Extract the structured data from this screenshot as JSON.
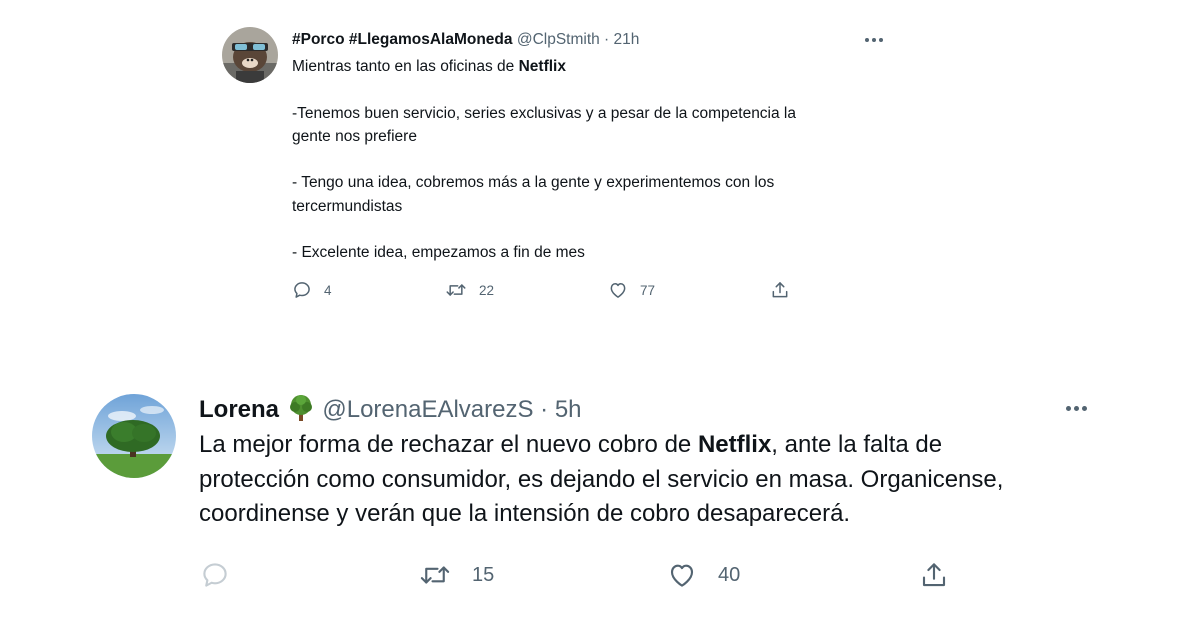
{
  "tweets": [
    {
      "display_name": "#Porco #LlegamosAlaMoneda",
      "handle": "@ClpStmith",
      "time": "21h",
      "text_intro": "Mientras tanto en las oficinas de ",
      "text_bold": "Netflix",
      "text_rest": "\n\n-Tenemos buen servicio, series exclusivas y a pesar de la competencia la\ngente nos prefiere\n\n- Tengo una idea, cobremos más a la gente y experimentemos con los\ntercermundistas\n\n- Excelente idea, empezamos a fin de mes",
      "replies": "4",
      "retweets": "22",
      "likes": "77",
      "avatar_icon": "cartoon-avatar"
    },
    {
      "display_name": "Lorena",
      "name_emoji": "tree-emoji",
      "handle": "@LorenaEAlvarezS",
      "time": "5h",
      "text_intro": "La mejor forma de rechazar el nuevo cobro de ",
      "text_bold": "Netflix",
      "text_rest": ", ante la falta de\nprotección como consumidor, es dejando el servicio en masa. Organicense,\ncoordinense y verán que la intensión de cobro desaparecerá.",
      "retweets": "15",
      "likes": "40",
      "avatar_icon": "tree-landscape-avatar"
    }
  ],
  "separator": " · ",
  "colors": {
    "text": "#0f1419",
    "muted": "#536471",
    "background": "#ffffff"
  },
  "icons": {
    "reply": "reply-icon",
    "retweet": "retweet-icon",
    "like": "like-icon",
    "share": "share-icon",
    "more": "more-icon"
  }
}
